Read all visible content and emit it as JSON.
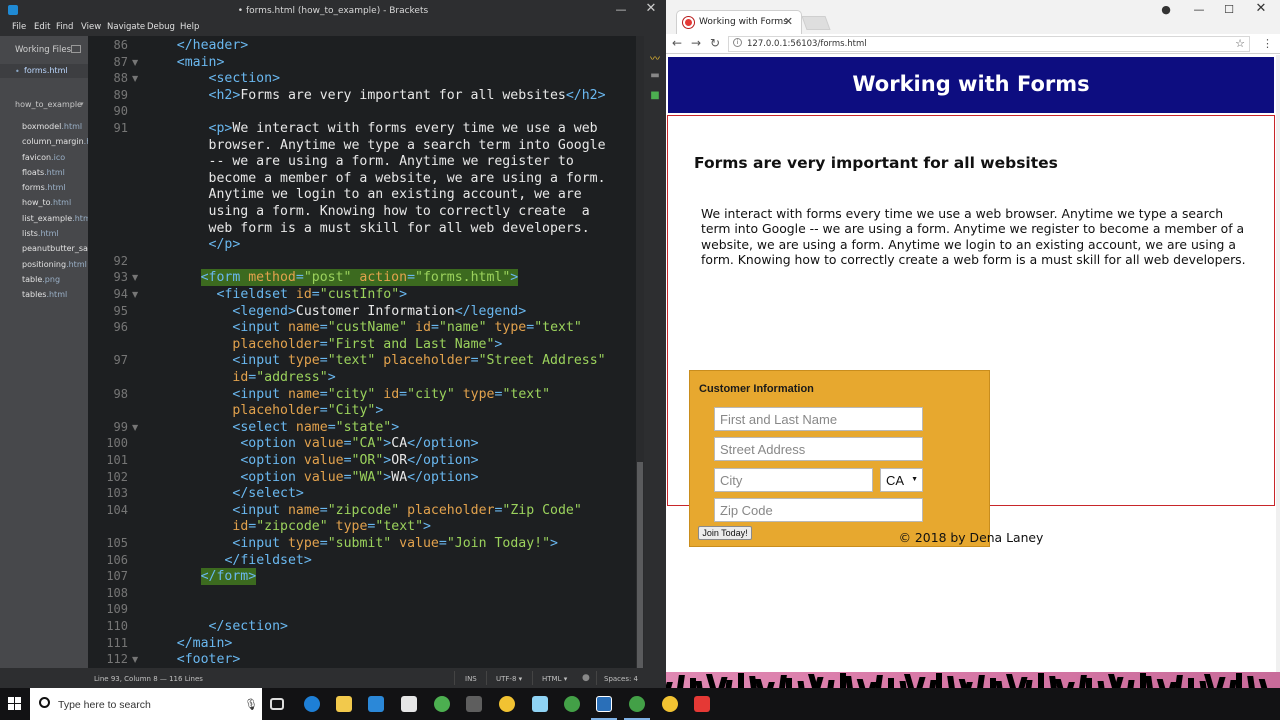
{
  "brackets": {
    "window_title": "• forms.html (how_to_example) - Brackets",
    "menu": [
      "File",
      "Edit",
      "Find",
      "View",
      "Navigate",
      "Debug",
      "Help"
    ],
    "sidebar": {
      "working_files_label": "Working Files",
      "working_file": "forms.html",
      "project": "how_to_example",
      "files": [
        {
          "name": "boxmodel",
          "ext": ".html"
        },
        {
          "name": "column_margin",
          "ext": ".h"
        },
        {
          "name": "favicon",
          "ext": ".ico"
        },
        {
          "name": "floats",
          "ext": ".html"
        },
        {
          "name": "forms",
          "ext": ".html"
        },
        {
          "name": "how_to",
          "ext": ".html"
        },
        {
          "name": "list_example",
          "ext": ".htm"
        },
        {
          "name": "lists",
          "ext": ".html"
        },
        {
          "name": "peanutbutter_sar",
          "ext": ""
        },
        {
          "name": "positioning",
          "ext": ".html"
        },
        {
          "name": "table",
          "ext": ".png"
        },
        {
          "name": "tables",
          "ext": ".html"
        }
      ]
    },
    "code_lines": [
      {
        "n": "86",
        "fold": "",
        "hl": false,
        "ind": 5,
        "segs": [
          [
            "tag",
            "</header>"
          ]
        ]
      },
      {
        "n": "87",
        "fold": "▼",
        "hl": false,
        "ind": 5,
        "segs": [
          [
            "tag",
            "<main>"
          ]
        ]
      },
      {
        "n": "88",
        "fold": "▼",
        "hl": false,
        "ind": 9,
        "segs": [
          [
            "tag",
            "<section>"
          ]
        ]
      },
      {
        "n": "89",
        "fold": "",
        "hl": false,
        "ind": 9,
        "segs": [
          [
            "tag",
            "<h2>"
          ],
          [
            "txt",
            "Forms are very important for all websites"
          ],
          [
            "tag",
            "</h2>"
          ]
        ]
      },
      {
        "n": "90",
        "fold": "",
        "hl": false,
        "ind": 0,
        "segs": []
      },
      {
        "n": "91",
        "fold": "",
        "hl": false,
        "ind": 9,
        "segs": [
          [
            "tag",
            "<p>"
          ],
          [
            "txt",
            "We interact with forms every time we use a web"
          ]
        ]
      },
      {
        "n": "",
        "fold": "",
        "hl": false,
        "ind": 9,
        "segs": [
          [
            "txt",
            "browser. Anytime we type a search term into Google"
          ]
        ]
      },
      {
        "n": "",
        "fold": "",
        "hl": false,
        "ind": 9,
        "segs": [
          [
            "txt",
            "-- we are using a form. Anytime we register to"
          ]
        ]
      },
      {
        "n": "",
        "fold": "",
        "hl": false,
        "ind": 9,
        "segs": [
          [
            "txt",
            "become a member of a website, we are using a form."
          ]
        ]
      },
      {
        "n": "",
        "fold": "",
        "hl": false,
        "ind": 9,
        "segs": [
          [
            "txt",
            "Anytime we login to an existing account, we are"
          ]
        ]
      },
      {
        "n": "",
        "fold": "",
        "hl": false,
        "ind": 9,
        "segs": [
          [
            "txt",
            "using a form. Knowing how to correctly create  a"
          ]
        ]
      },
      {
        "n": "",
        "fold": "",
        "hl": false,
        "ind": 9,
        "segs": [
          [
            "txt",
            "web form is a must skill for all web developers."
          ]
        ]
      },
      {
        "n": "",
        "fold": "",
        "hl": false,
        "ind": 9,
        "segs": [
          [
            "tag",
            "</p>"
          ]
        ]
      },
      {
        "n": "92",
        "fold": "",
        "hl": false,
        "ind": 0,
        "segs": []
      },
      {
        "n": "93",
        "fold": "▼",
        "hl": true,
        "ind": 8,
        "segs": [
          [
            "tag",
            "<form "
          ],
          [
            "attr",
            "method"
          ],
          [
            "tag",
            "="
          ],
          [
            "val",
            "\"post\""
          ],
          [
            "tag",
            " "
          ],
          [
            "attr",
            "action"
          ],
          [
            "tag",
            "="
          ],
          [
            "val",
            "\"forms.html\""
          ],
          [
            "tag",
            ">"
          ]
        ]
      },
      {
        "n": "94",
        "fold": "▼",
        "hl": false,
        "ind": 10,
        "segs": [
          [
            "tag",
            "<fieldset "
          ],
          [
            "attr",
            "id"
          ],
          [
            "tag",
            "="
          ],
          [
            "val",
            "\"custInfo\""
          ],
          [
            "tag",
            ">"
          ]
        ]
      },
      {
        "n": "95",
        "fold": "",
        "hl": false,
        "ind": 12,
        "segs": [
          [
            "tag",
            "<legend>"
          ],
          [
            "txt",
            "Customer Information"
          ],
          [
            "tag",
            "</legend>"
          ]
        ]
      },
      {
        "n": "96",
        "fold": "",
        "hl": false,
        "ind": 12,
        "segs": [
          [
            "tag",
            "<input "
          ],
          [
            "attr",
            "name"
          ],
          [
            "tag",
            "="
          ],
          [
            "val",
            "\"custName\""
          ],
          [
            "tag",
            " "
          ],
          [
            "attr",
            "id"
          ],
          [
            "tag",
            "="
          ],
          [
            "val",
            "\"name\""
          ],
          [
            "tag",
            " "
          ],
          [
            "attr",
            "type"
          ],
          [
            "tag",
            "="
          ],
          [
            "val",
            "\"text\""
          ]
        ]
      },
      {
        "n": "",
        "fold": "",
        "hl": false,
        "ind": 12,
        "segs": [
          [
            "attr",
            "placeholder"
          ],
          [
            "tag",
            "="
          ],
          [
            "val",
            "\"First and Last Name\""
          ],
          [
            "tag",
            ">"
          ]
        ]
      },
      {
        "n": "97",
        "fold": "",
        "hl": false,
        "ind": 12,
        "segs": [
          [
            "tag",
            "<input "
          ],
          [
            "attr",
            "type"
          ],
          [
            "tag",
            "="
          ],
          [
            "val",
            "\"text\""
          ],
          [
            "tag",
            " "
          ],
          [
            "attr",
            "placeholder"
          ],
          [
            "tag",
            "="
          ],
          [
            "val",
            "\"Street Address\""
          ]
        ]
      },
      {
        "n": "",
        "fold": "",
        "hl": false,
        "ind": 12,
        "segs": [
          [
            "attr",
            "id"
          ],
          [
            "tag",
            "="
          ],
          [
            "val",
            "\"address\""
          ],
          [
            "tag",
            ">"
          ]
        ]
      },
      {
        "n": "98",
        "fold": "",
        "hl": false,
        "ind": 12,
        "segs": [
          [
            "tag",
            "<input "
          ],
          [
            "attr",
            "name"
          ],
          [
            "tag",
            "="
          ],
          [
            "val",
            "\"city\""
          ],
          [
            "tag",
            " "
          ],
          [
            "attr",
            "id"
          ],
          [
            "tag",
            "="
          ],
          [
            "val",
            "\"city\""
          ],
          [
            "tag",
            " "
          ],
          [
            "attr",
            "type"
          ],
          [
            "tag",
            "="
          ],
          [
            "val",
            "\"text\""
          ]
        ]
      },
      {
        "n": "",
        "fold": "",
        "hl": false,
        "ind": 12,
        "segs": [
          [
            "attr",
            "placeholder"
          ],
          [
            "tag",
            "="
          ],
          [
            "val",
            "\"City\""
          ],
          [
            "tag",
            ">"
          ]
        ]
      },
      {
        "n": "99",
        "fold": "▼",
        "hl": false,
        "ind": 12,
        "segs": [
          [
            "tag",
            "<select "
          ],
          [
            "attr",
            "name"
          ],
          [
            "tag",
            "="
          ],
          [
            "val",
            "\"state\""
          ],
          [
            "tag",
            ">"
          ]
        ]
      },
      {
        "n": "100",
        "fold": "",
        "hl": false,
        "ind": 13,
        "segs": [
          [
            "tag",
            "<option "
          ],
          [
            "attr",
            "value"
          ],
          [
            "tag",
            "="
          ],
          [
            "val",
            "\"CA\""
          ],
          [
            "tag",
            ">"
          ],
          [
            "txt",
            "CA"
          ],
          [
            "tag",
            "</option>"
          ]
        ]
      },
      {
        "n": "101",
        "fold": "",
        "hl": false,
        "ind": 13,
        "segs": [
          [
            "tag",
            "<option "
          ],
          [
            "attr",
            "value"
          ],
          [
            "tag",
            "="
          ],
          [
            "val",
            "\"OR\""
          ],
          [
            "tag",
            ">"
          ],
          [
            "txt",
            "OR"
          ],
          [
            "tag",
            "</option>"
          ]
        ]
      },
      {
        "n": "102",
        "fold": "",
        "hl": false,
        "ind": 13,
        "segs": [
          [
            "tag",
            "<option "
          ],
          [
            "attr",
            "value"
          ],
          [
            "tag",
            "="
          ],
          [
            "val",
            "\"WA\""
          ],
          [
            "tag",
            ">"
          ],
          [
            "txt",
            "WA"
          ],
          [
            "tag",
            "</option>"
          ]
        ]
      },
      {
        "n": "103",
        "fold": "",
        "hl": false,
        "ind": 12,
        "segs": [
          [
            "tag",
            "</select>"
          ]
        ]
      },
      {
        "n": "104",
        "fold": "",
        "hl": false,
        "ind": 12,
        "segs": [
          [
            "tag",
            "<input "
          ],
          [
            "attr",
            "name"
          ],
          [
            "tag",
            "="
          ],
          [
            "val",
            "\"zipcode\""
          ],
          [
            "tag",
            " "
          ],
          [
            "attr",
            "placeholder"
          ],
          [
            "tag",
            "="
          ],
          [
            "val",
            "\"Zip Code\""
          ]
        ]
      },
      {
        "n": "",
        "fold": "",
        "hl": false,
        "ind": 12,
        "segs": [
          [
            "attr",
            "id"
          ],
          [
            "tag",
            "="
          ],
          [
            "val",
            "\"zipcode\""
          ],
          [
            "tag",
            " "
          ],
          [
            "attr",
            "type"
          ],
          [
            "tag",
            "="
          ],
          [
            "val",
            "\"text\""
          ],
          [
            "tag",
            ">"
          ]
        ]
      },
      {
        "n": "105",
        "fold": "",
        "hl": false,
        "ind": 12,
        "segs": [
          [
            "tag",
            "<input "
          ],
          [
            "attr",
            "type"
          ],
          [
            "tag",
            "="
          ],
          [
            "val",
            "\"submit\""
          ],
          [
            "tag",
            " "
          ],
          [
            "attr",
            "value"
          ],
          [
            "tag",
            "="
          ],
          [
            "val",
            "\"Join Today!\""
          ],
          [
            "tag",
            ">"
          ]
        ]
      },
      {
        "n": "106",
        "fold": "",
        "hl": false,
        "ind": 11,
        "segs": [
          [
            "tag",
            "</fieldset>"
          ]
        ]
      },
      {
        "n": "107",
        "fold": "",
        "hl": true,
        "ind": 8,
        "segs": [
          [
            "tag",
            "</form>"
          ]
        ]
      },
      {
        "n": "108",
        "fold": "",
        "hl": false,
        "ind": 0,
        "segs": []
      },
      {
        "n": "109",
        "fold": "",
        "hl": false,
        "ind": 0,
        "segs": []
      },
      {
        "n": "110",
        "fold": "",
        "hl": false,
        "ind": 9,
        "segs": [
          [
            "tag",
            "</section>"
          ]
        ]
      },
      {
        "n": "111",
        "fold": "",
        "hl": false,
        "ind": 5,
        "segs": [
          [
            "tag",
            "</main>"
          ]
        ]
      },
      {
        "n": "112",
        "fold": "▼",
        "hl": false,
        "ind": 5,
        "segs": [
          [
            "tag",
            "<footer>"
          ]
        ]
      }
    ],
    "status": {
      "cursor": "Line 93, Column 8 — 116 Lines",
      "mode": "INS",
      "encoding": "UTF-8 ▾",
      "language": "HTML ▾",
      "spaces": "Spaces: 4"
    }
  },
  "chrome": {
    "tab_title": "Working with Forms",
    "url": "127.0.0.1:56103/forms.html",
    "page": {
      "header": "Working with Forms",
      "h2": "Forms are very important for all websites",
      "paragraph": "We interact with forms every time we use a web browser. Anytime we type a search term into Google -- we are using a form. Anytime we register to become a member of a website, we are using a form. Anytime we login to an existing account, we are using a form. Knowing how to correctly create a web form is a must skill for all web developers.",
      "legend": "Customer Information",
      "name_placeholder": "First and Last Name",
      "address_placeholder": "Street Address",
      "city_placeholder": "City",
      "state_selected": "CA",
      "zip_placeholder": "Zip Code",
      "submit_label": "Join Today!",
      "footer": "© 2018 by Dena Laney"
    }
  },
  "taskbar": {
    "search_placeholder": "Type here to search"
  },
  "colors": {
    "editor_bg": "#1d1f21",
    "tag": "#6ab8f0",
    "attr": "#e2a24d",
    "value": "#9bd25c",
    "highlight": "#3c6a1f",
    "page_header_bg": "#0d0d80",
    "fieldset_bg": "#e7a82f",
    "main_border": "#c8262a"
  }
}
